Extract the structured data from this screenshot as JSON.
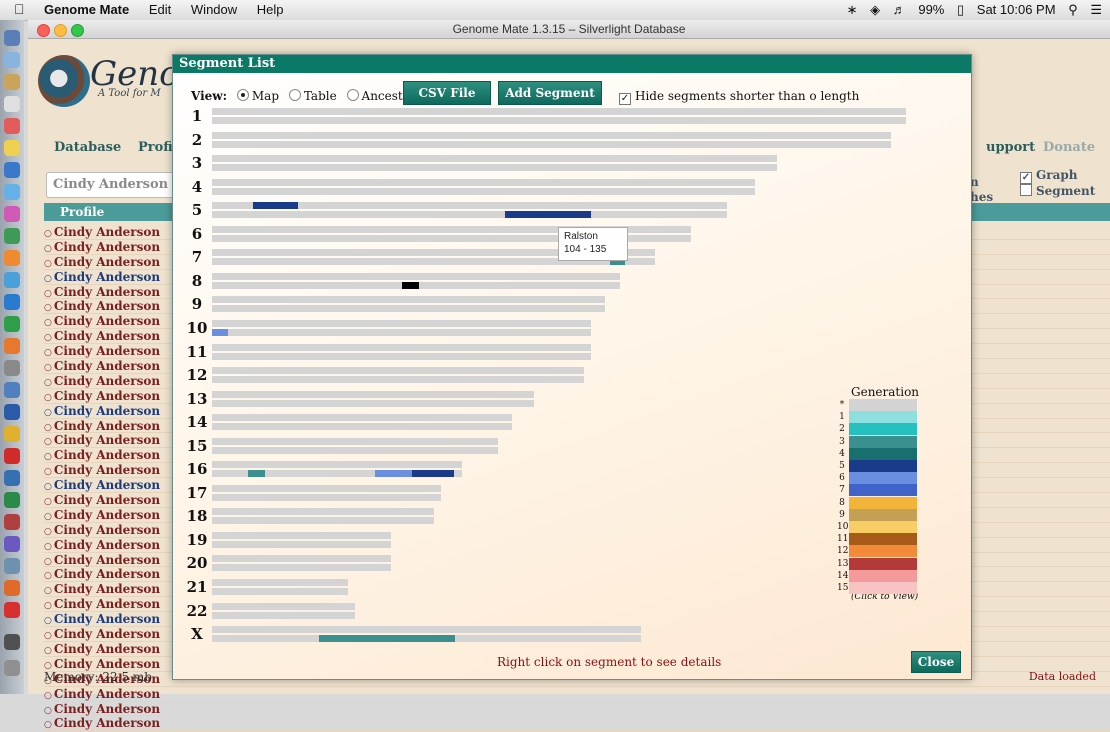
{
  "menubar": {
    "apple": "",
    "app_name": "Genome Mate",
    "menus": [
      "Edit",
      "Window",
      "Help"
    ],
    "battery": "99%",
    "clock": "Sat 10:06 PM"
  },
  "window": {
    "title": "Genome Mate 1.3.15 – Silverlight Database"
  },
  "background": {
    "logo_text": "Geno",
    "logo_sub": "A Tool for M",
    "nav": [
      "Database",
      "Profi",
      "upport",
      "Donate"
    ],
    "search_value": "Cindy Anderson",
    "options": [
      "Graph",
      "Segment"
    ],
    "partial_labels": [
      "n",
      "hes"
    ],
    "table_header": "Profile",
    "profile_rows": [
      {
        "name": "Cindy Anderson",
        "color": "red"
      },
      {
        "name": "Cindy Anderson",
        "color": "red"
      },
      {
        "name": "Cindy Anderson",
        "color": "red"
      },
      {
        "name": "Cindy Anderson",
        "color": "blue"
      },
      {
        "name": "Cindy Anderson",
        "color": "red"
      },
      {
        "name": "Cindy Anderson",
        "color": "red"
      },
      {
        "name": "Cindy Anderson",
        "color": "red"
      },
      {
        "name": "Cindy Anderson",
        "color": "red"
      },
      {
        "name": "Cindy Anderson",
        "color": "red"
      },
      {
        "name": "Cindy Anderson",
        "color": "red"
      },
      {
        "name": "Cindy Anderson",
        "color": "red"
      },
      {
        "name": "Cindy Anderson",
        "color": "red"
      },
      {
        "name": "Cindy Anderson",
        "color": "blue"
      },
      {
        "name": "Cindy Anderson",
        "color": "red"
      },
      {
        "name": "Cindy Anderson",
        "color": "red"
      },
      {
        "name": "Cindy Anderson",
        "color": "red"
      },
      {
        "name": "Cindy Anderson",
        "color": "red"
      },
      {
        "name": "Cindy Anderson",
        "color": "blue"
      },
      {
        "name": "Cindy Anderson",
        "color": "red"
      },
      {
        "name": "Cindy Anderson",
        "color": "red"
      },
      {
        "name": "Cindy Anderson",
        "color": "red"
      },
      {
        "name": "Cindy Anderson",
        "color": "red"
      },
      {
        "name": "Cindy Anderson",
        "color": "red"
      },
      {
        "name": "Cindy Anderson",
        "color": "red"
      },
      {
        "name": "Cindy Anderson",
        "color": "red"
      },
      {
        "name": "Cindy Anderson",
        "color": "red"
      },
      {
        "name": "Cindy Anderson",
        "color": "blue"
      },
      {
        "name": "Cindy Anderson",
        "color": "red"
      },
      {
        "name": "Cindy Anderson",
        "color": "red"
      },
      {
        "name": "Cindy Anderson",
        "color": "red"
      },
      {
        "name": "Cindy Anderson",
        "color": "red"
      },
      {
        "name": "Cindy Anderson",
        "color": "red"
      },
      {
        "name": "Cindy Anderson",
        "color": "red"
      },
      {
        "name": "Cindy Anderson",
        "color": "red"
      }
    ],
    "memory": "Memory: 22.5 mb",
    "status": "Data loaded"
  },
  "dialog": {
    "title": "Segment List",
    "view_label": "View:",
    "view_options": [
      "Map",
      "Table",
      "Ancestry"
    ],
    "selected_view": "Map",
    "csv_button": "CSV File",
    "add_button": "Add Segment",
    "hide_label": "Hide segments shorter than o length",
    "hide_checked": true,
    "tooltip": {
      "name": "Ralston",
      "range": "104 - 135"
    },
    "footer": "Right click on segment to see details",
    "close_button": "Close"
  },
  "chromosomes": [
    {
      "label": "1",
      "length": 0.97,
      "segments": []
    },
    {
      "label": "2",
      "length": 0.95,
      "segments": []
    },
    {
      "label": "3",
      "length": 0.79,
      "segments": []
    },
    {
      "label": "4",
      "length": 0.76,
      "segments": []
    },
    {
      "label": "5",
      "length": 0.72,
      "segments": [
        {
          "start": 0.058,
          "end": 0.12,
          "gen": 5,
          "row": 0
        },
        {
          "start": 0.41,
          "end": 0.53,
          "gen": 5,
          "row": 1
        }
      ]
    },
    {
      "label": "6",
      "length": 0.67,
      "segments": []
    },
    {
      "label": "7",
      "length": 0.62,
      "segments": [
        {
          "start": 0.556,
          "end": 0.578,
          "gen": 3,
          "row": 1
        }
      ]
    },
    {
      "label": "8",
      "length": 0.57,
      "segments": [
        {
          "start": 0.266,
          "end": 0.289,
          "gen": 0,
          "row": 1,
          "color": "#000000"
        }
      ]
    },
    {
      "label": "9",
      "length": 0.55,
      "segments": []
    },
    {
      "label": "10",
      "length": 0.53,
      "segments": [
        {
          "start": 0.0,
          "end": 0.023,
          "gen": 6,
          "row": 1
        }
      ]
    },
    {
      "label": "11",
      "length": 0.53,
      "segments": []
    },
    {
      "label": "12",
      "length": 0.52,
      "segments": []
    },
    {
      "label": "13",
      "length": 0.45,
      "segments": []
    },
    {
      "label": "14",
      "length": 0.42,
      "segments": []
    },
    {
      "label": "15",
      "length": 0.4,
      "segments": []
    },
    {
      "label": "16",
      "length": 0.35,
      "segments": [
        {
          "start": 0.05,
          "end": 0.074,
          "gen": 3,
          "row": 1
        },
        {
          "start": 0.228,
          "end": 0.28,
          "gen": 6,
          "row": 1
        },
        {
          "start": 0.28,
          "end": 0.339,
          "gen": 5,
          "row": 1
        }
      ]
    },
    {
      "label": "17",
      "length": 0.32,
      "segments": []
    },
    {
      "label": "18",
      "length": 0.31,
      "segments": []
    },
    {
      "label": "19",
      "length": 0.25,
      "segments": []
    },
    {
      "label": "20",
      "length": 0.25,
      "segments": []
    },
    {
      "label": "21",
      "length": 0.19,
      "segments": []
    },
    {
      "label": "22",
      "length": 0.2,
      "segments": []
    },
    {
      "label": "X",
      "length": 0.6,
      "segments": [
        {
          "start": 0.15,
          "end": 0.34,
          "gen": 3,
          "row": 1
        }
      ]
    }
  ],
  "legend": {
    "title": "Generation",
    "items": [
      {
        "label": "*",
        "color": "#d3d3d3"
      },
      {
        "label": "1",
        "color": "#8ee0e0"
      },
      {
        "label": "2",
        "color": "#27c0c0"
      },
      {
        "label": "3",
        "color": "#3b8f8f"
      },
      {
        "label": "4",
        "color": "#17706e"
      },
      {
        "label": "5",
        "color": "#1a3a8a"
      },
      {
        "label": "6",
        "color": "#6b8fe0"
      },
      {
        "label": "7",
        "color": "#3f63c9"
      },
      {
        "label": "8",
        "color": "#f3b43a"
      },
      {
        "label": "9",
        "color": "#c4a055"
      },
      {
        "label": "10",
        "color": "#f9cd66"
      },
      {
        "label": "11",
        "color": "#a85a18"
      },
      {
        "label": "12",
        "color": "#f38a3a"
      },
      {
        "label": "13",
        "color": "#b43a3a"
      },
      {
        "label": "14",
        "color": "#f59a9a"
      },
      {
        "label": "15",
        "color": "#f7c3c3"
      }
    ],
    "note": "(Click to View)"
  }
}
